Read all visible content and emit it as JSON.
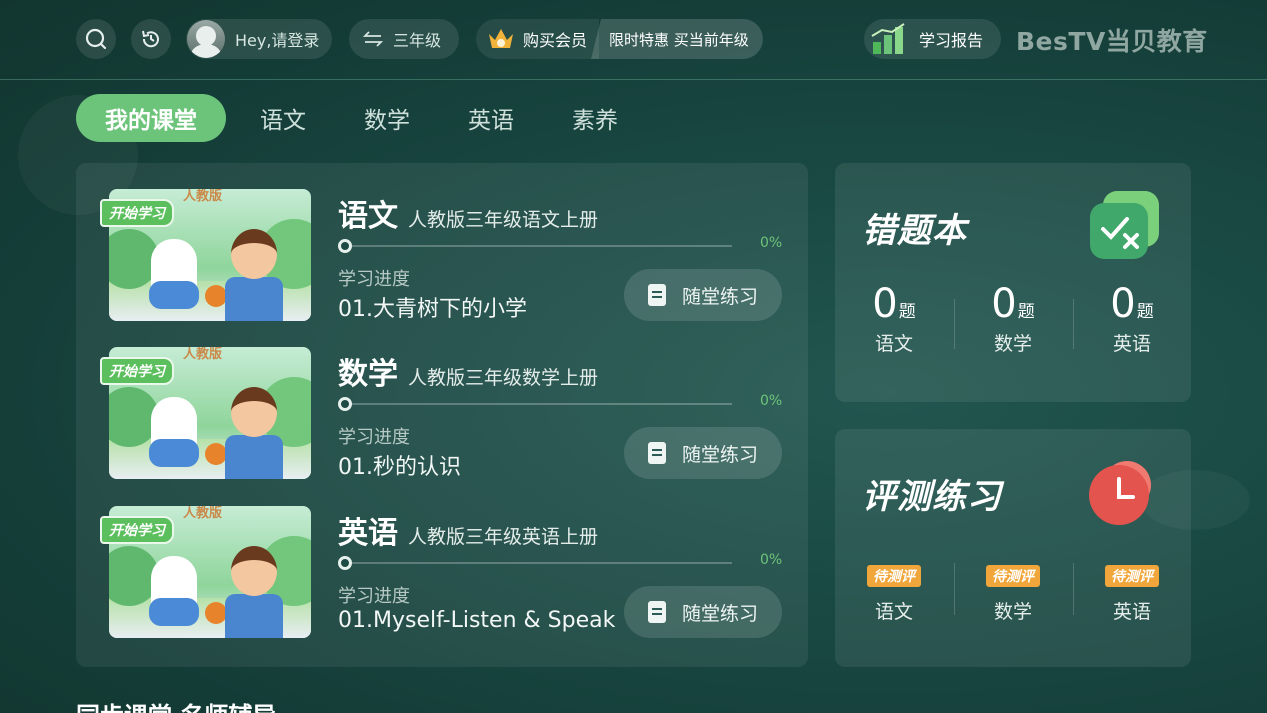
{
  "header": {
    "login_label": "Hey,请登录",
    "grade_label": "三年级",
    "vip_label": "购买会员",
    "vip_promo": "限时特惠 买当前年级",
    "report_label": "学习报告",
    "brand": "BesTV当贝教育"
  },
  "tabs": [
    "我的课堂",
    "语文",
    "数学",
    "英语",
    "素养"
  ],
  "courses": [
    {
      "badge": "开始学习",
      "press": "人教版",
      "subject": "语文",
      "book": "人教版三年级语文上册",
      "progress_pct": 0,
      "progress_text": "0%",
      "progress_label": "学习进度",
      "lesson": "01.大青树下的小学",
      "practice": "随堂练习"
    },
    {
      "badge": "开始学习",
      "press": "人教版",
      "subject": "数学",
      "book": "人教版三年级数学上册",
      "progress_pct": 0,
      "progress_text": "0%",
      "progress_label": "学习进度",
      "lesson": "01.秒的认识",
      "practice": "随堂练习"
    },
    {
      "badge": "开始学习",
      "press": "人教版",
      "subject": "英语",
      "book": "人教版三年级英语上册",
      "progress_pct": 0,
      "progress_text": "0%",
      "progress_label": "学习进度",
      "lesson": "01.Myself-Listen & Speak",
      "practice": "随堂练习"
    }
  ],
  "mistakes": {
    "title": "错题本",
    "stats": [
      {
        "count": "0",
        "unit": "题",
        "subject": "语文"
      },
      {
        "count": "0",
        "unit": "题",
        "subject": "数学"
      },
      {
        "count": "0",
        "unit": "题",
        "subject": "英语"
      }
    ]
  },
  "assessment": {
    "title": "评测练习",
    "items": [
      {
        "status": "待测评",
        "subject": "语文"
      },
      {
        "status": "待测评",
        "subject": "数学"
      },
      {
        "status": "待测评",
        "subject": "英语"
      }
    ]
  },
  "section_title": "同步课堂 名师辅导",
  "colors": {
    "accent": "#6cc47a",
    "pending": "#f0a63a",
    "background": "#1a4a44"
  }
}
